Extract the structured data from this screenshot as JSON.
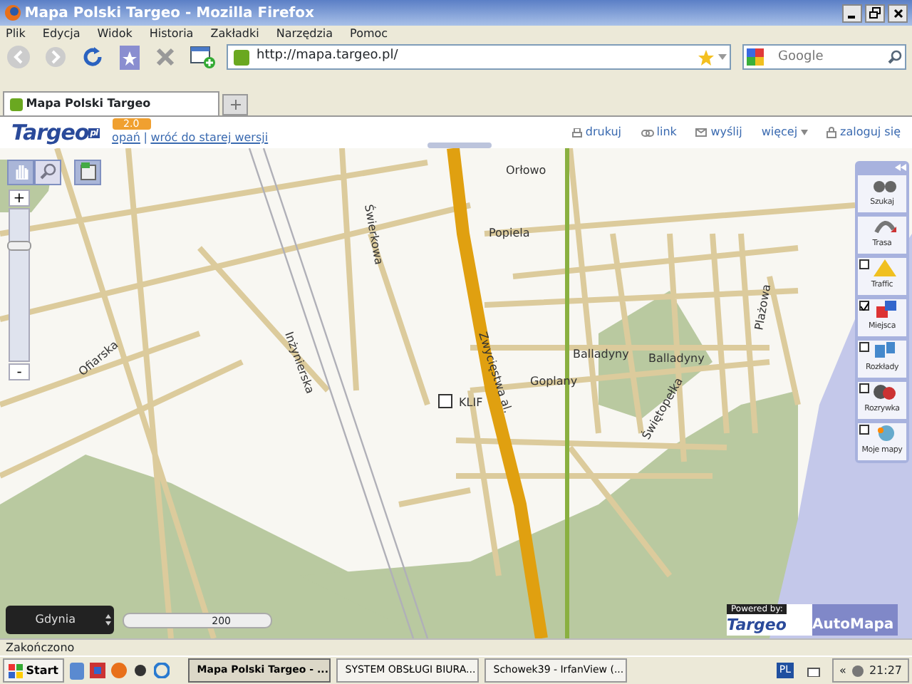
{
  "window": {
    "title": "Mapa Polski Targeo - Mozilla Firefox"
  },
  "menu": [
    "Plik",
    "Edycja",
    "Widok",
    "Historia",
    "Zakładki",
    "Narzędzia",
    "Pomoc"
  ],
  "toolbar": {
    "url": "http://mapa.targeo.pl/",
    "search_placeholder": "Google"
  },
  "tabs": [
    {
      "label": "Mapa Polski Targeo",
      "selected": true
    }
  ],
  "site_header": {
    "logo": "Targeo",
    "logo_suffix": "pl",
    "version_badge": "2.0",
    "links": [
      "opań",
      "wróć do starej wersji"
    ],
    "links_separator": "|",
    "actions": [
      "drukuj",
      "link",
      "wyślij",
      "więcej",
      "zaloguj się"
    ]
  },
  "map": {
    "zoom": {
      "plus": "+",
      "minus": "-",
      "level": 0.78
    },
    "labels": [
      "Orłowo",
      "Popiela",
      "Świerkowa",
      "Zwycięstwa al.",
      "Balladyny",
      "Balladyny",
      "Goplany",
      "Świętopełka",
      "Ofiarska",
      "KLIF",
      "Plażowa",
      "Inżynierska"
    ],
    "location": "Gdynia",
    "scale": "200",
    "panel": [
      {
        "label": "Szukaj",
        "kind": "tool"
      },
      {
        "label": "Trasa",
        "kind": "tool"
      },
      {
        "label": "Traffic",
        "kind": "layer",
        "checked": false
      },
      {
        "label": "Miejsca",
        "kind": "layer",
        "checked": true
      },
      {
        "label": "Rozkłady",
        "kind": "layer",
        "checked": false
      },
      {
        "label": "Rozrywka",
        "kind": "layer",
        "checked": false
      },
      {
        "label": "Moje mapy",
        "kind": "layer",
        "checked": false
      }
    ],
    "powered": {
      "caption": "Powered by:",
      "brand_left": "Targeo",
      "brand_right": "AutoMapa"
    }
  },
  "status_bar": "Zakończono",
  "taskbar": {
    "start": "Start",
    "tasks": [
      {
        "label": "Mapa Polski Targeo - ...",
        "selected": true
      },
      {
        "label": "SYSTEM OBSŁUGI BIURA...",
        "selected": false
      },
      {
        "label": "Schowek39 - IrfanView (...",
        "selected": false
      }
    ],
    "language": "PL",
    "tray_toggle": "«",
    "clock": "21:27"
  }
}
